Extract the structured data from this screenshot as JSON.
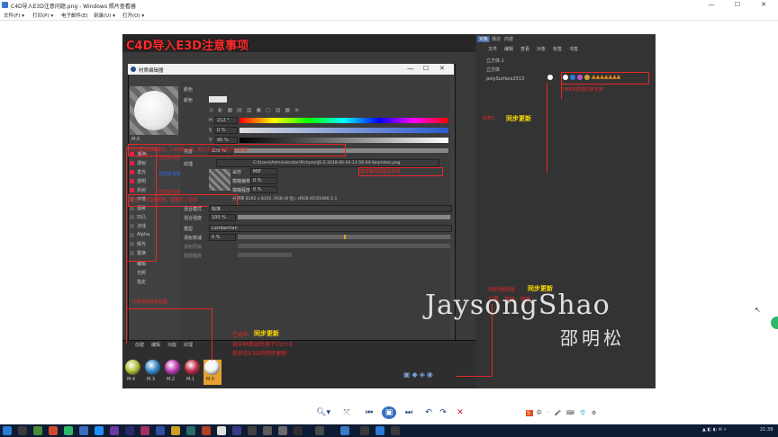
{
  "window": {
    "title": "C4D导入E3D注意问题.png - Windows 照片查看器",
    "controls": [
      "—",
      "☐",
      "✕"
    ]
  },
  "menu": [
    {
      "label": "文件(F) ▾"
    },
    {
      "label": "打印(P) ▾"
    },
    {
      "label": "电子邮件(E)"
    },
    {
      "label": "刻录(U) ▾"
    },
    {
      "label": "打开(O) ▾"
    }
  ],
  "c4d": {
    "heading": "C4D导入E3D注意事项",
    "panel_tabs": [
      "对象",
      "场次",
      "内容"
    ],
    "panel_menu": [
      "文件",
      "编辑",
      "查看",
      "对象",
      "标签",
      "书签"
    ],
    "objects": [
      "立方体.1",
      "立方体",
      "polySurface2513"
    ],
    "editor_title": "材质编辑器",
    "material_name": "M.0",
    "color_section": "颜色",
    "color_label": "颜色",
    "h_value": "212 °",
    "s_value": "0 %",
    "v_value": "90 %",
    "brightness_label": "亮度",
    "brightness_value": "100 %",
    "texture_label": "纹理",
    "texture_path": "C:\\Users\\Administrator\\Pictures\\JS-2-2018-06-10-13-56-04-Seamless.png",
    "sampling_label": "采样",
    "sampling_value": "MIP",
    "blur_offset_label": "模糊偏移",
    "blur_scale_label": "模糊程度",
    "blur_value": "0 %",
    "resolution": "分辨率 8192 x 8192, RGB (8 位), sRGB IEC61966-2.1",
    "mix_mode_label": "混合模式",
    "mix_mode_value": "标准",
    "mix_strength_label": "混合强度",
    "mix_strength_value": "100 %",
    "model_label": "模型",
    "model_value": "Lambertian",
    "diffuse_falloff_label": "漫射衰减",
    "diffuse_falloff_value": "0 %",
    "diffuse_level_label": "漫射层级",
    "roughness_label": "粗糙程度",
    "channels": [
      "颜色",
      "漫射",
      "发光",
      "透明",
      "反射",
      "环境",
      "烟雾",
      "凹凸",
      "法线",
      "Alpha",
      "辉光",
      "置换"
    ],
    "extra_channels": [
      "编辑",
      "光照",
      "指定"
    ],
    "mat_manager_tabs": [
      "创建",
      "编辑",
      "功能",
      "纹理"
    ],
    "materials": [
      {
        "name": "M.4",
        "color": "#b7c43a"
      },
      {
        "name": "M.3",
        "color": "#3b8ccf"
      },
      {
        "name": "M.2",
        "color": "#c040b8"
      },
      {
        "name": "M.1",
        "color": "#c0304a"
      },
      {
        "name": "M.0",
        "color": "#f2f2f2"
      }
    ],
    "annotations": {
      "texture_note_1": "可以调节基础属性，C4D默认值，默认支持，需要导入复制",
      "texture_note_2": "高光，不同步更新，需要导入更新",
      "supported": "已同步支持",
      "supported_2": "已同步支持",
      "emit": "已同步支持",
      "pick": "可以点这个贴图路径，同步更新",
      "path_note": "指定路径贴图文件夹",
      "only_col": "只支持固有色贴图",
      "tag_note_1": "标签2",
      "tag_sync": "同步更新",
      "tag_right": "PBR材质球同步支持",
      "bottom_red_1": "已选中",
      "bottom_sync": "同步更新",
      "bottom_red_2": "选中材质球后按下Ctrl+E",
      "bottom_red_3": "然后在E3D内同步更新",
      "pbr_red_1": "PBR材质球",
      "pbr_sync": "同步更新",
      "pbr_red_2": "位置、旋转、缩放"
    },
    "signature_latin": "JaysongShao",
    "signature_cn": "邵明松"
  },
  "viewer_controls": [
    {
      "name": "zoom",
      "glyph": "🔍︎▾"
    },
    {
      "name": "actual-size",
      "glyph": "⤧"
    },
    {
      "name": "previous",
      "glyph": "⏮"
    },
    {
      "name": "slideshow",
      "glyph": "▣"
    },
    {
      "name": "next",
      "glyph": "⏭"
    },
    {
      "name": "rotate-ccw",
      "glyph": "↶"
    },
    {
      "name": "rotate-cw",
      "glyph": "↷"
    },
    {
      "name": "delete",
      "glyph": "✕"
    }
  ],
  "taskbar": {
    "clock": "21:39",
    "tray_icons": [
      "S",
      "中",
      "·",
      "🎤",
      "⌨",
      "👕",
      "⚙"
    ]
  },
  "colors": {
    "accent_red": "#e8262a",
    "accent_yellow": "#ffdd00",
    "taskbar": "#0d1b33"
  }
}
